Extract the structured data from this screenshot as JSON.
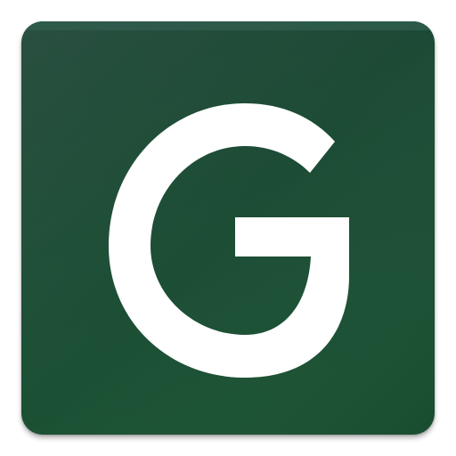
{
  "icon": {
    "name": "G",
    "colors": {
      "tile_top": "#1e4636",
      "tile_bottom": "#1b5234",
      "tile_edge_highlight": "#2f5d4c",
      "glyph": "#ffffff"
    }
  }
}
